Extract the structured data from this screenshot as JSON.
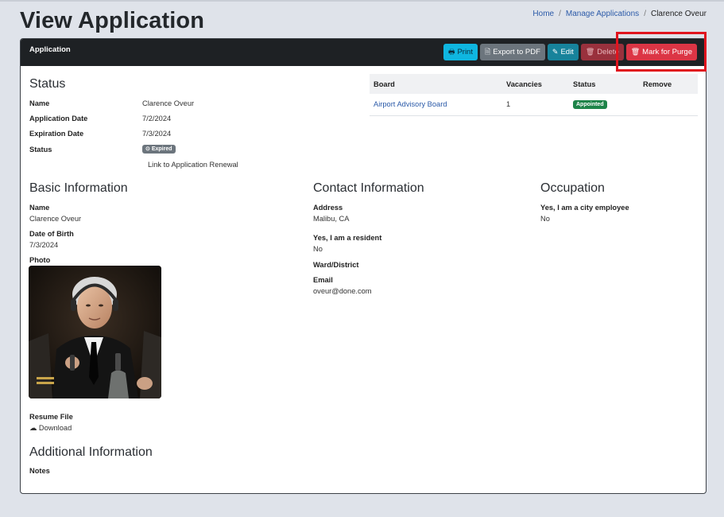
{
  "page": {
    "title": "View Application"
  },
  "breadcrumb": {
    "home": "Home",
    "manage": "Manage Applications",
    "current": "Clarence Oveur"
  },
  "card": {
    "title": "Application"
  },
  "toolbar": {
    "print": "Print",
    "export_pdf": "Export to PDF",
    "edit": "Edit",
    "delete": "Delete",
    "mark_for_purge": "Mark for Purge"
  },
  "status": {
    "heading": "Status",
    "name_label": "Name",
    "name_value": "Clarence Oveur",
    "application_date_label": "Application Date",
    "application_date_value": "7/2/2024",
    "expiration_date_label": "Expiration Date",
    "expiration_date_value": "7/3/2024",
    "status_label": "Status",
    "status_badge": "Expired",
    "renewal_link": "Link to Application Renewal"
  },
  "boards": {
    "columns": [
      "Board",
      "Vacancies",
      "Status",
      "Remove"
    ],
    "rows": [
      {
        "board": "Airport Advisory Board",
        "vacancies": "1",
        "status": "Appointed",
        "remove": ""
      }
    ]
  },
  "basic": {
    "heading": "Basic Information",
    "name_label": "Name",
    "name_value": "Clarence Oveur",
    "dob_label": "Date of Birth",
    "dob_value": "7/3/2024",
    "photo_label": "Photo",
    "resume_label": "Resume File",
    "download_link": "Download"
  },
  "contact": {
    "heading": "Contact Information",
    "address_label": "Address",
    "address_value": "Malibu, CA",
    "resident_label": "Yes, I am a resident",
    "resident_value": "No",
    "ward_label": "Ward/District",
    "email_label": "Email",
    "email_value": "oveur@done.com"
  },
  "occupation": {
    "heading": "Occupation",
    "employee_label": "Yes, I am a city employee",
    "employee_value": "No"
  },
  "additional": {
    "heading": "Additional Information",
    "notes_label": "Notes"
  },
  "colors": {
    "header_bg": "#1e2124",
    "print": "#0fb6e0",
    "export": "#6c757d",
    "edit": "#17839b",
    "delete": "#99313d",
    "purge": "#dc3545",
    "highlight": "#e0141e",
    "link": "#2b5aa8",
    "appointed": "#1e8449"
  }
}
